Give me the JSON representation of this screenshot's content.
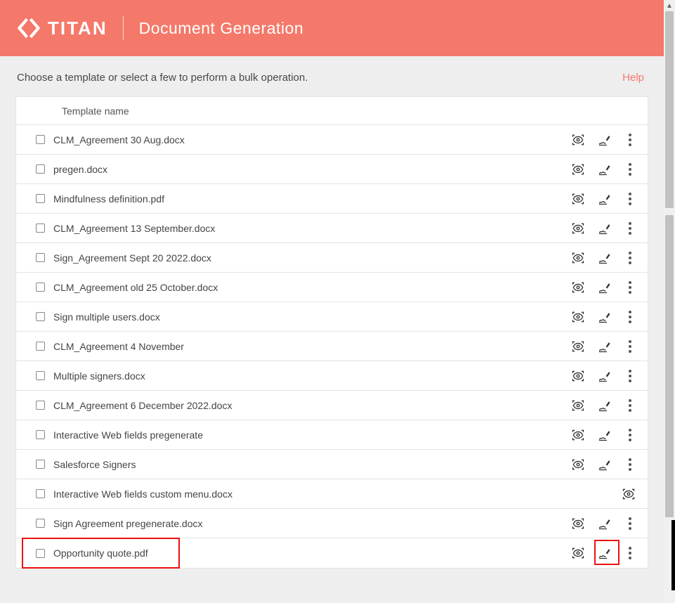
{
  "header": {
    "brand": "TITAN",
    "title": "Document Generation"
  },
  "subhead": {
    "instruction": "Choose a template or select a few to perform a bulk operation.",
    "help": "Help"
  },
  "table": {
    "column_header": "Template name",
    "rows": [
      {
        "name": "CLM_Agreement 30 Aug.docx",
        "preview": true,
        "sign": true,
        "more": true
      },
      {
        "name": "pregen.docx",
        "preview": true,
        "sign": true,
        "more": true
      },
      {
        "name": "Mindfulness definition.pdf",
        "preview": true,
        "sign": true,
        "more": true
      },
      {
        "name": "CLM_Agreement 13 September.docx",
        "preview": true,
        "sign": true,
        "more": true
      },
      {
        "name": "Sign_Agreement Sept 20 2022.docx",
        "preview": true,
        "sign": true,
        "more": true
      },
      {
        "name": "CLM_Agreement old 25 October.docx",
        "preview": true,
        "sign": true,
        "more": true
      },
      {
        "name": "Sign multiple users.docx",
        "preview": true,
        "sign": true,
        "more": true
      },
      {
        "name": "CLM_Agreement 4 November",
        "preview": true,
        "sign": true,
        "more": true
      },
      {
        "name": "Multiple signers.docx",
        "preview": true,
        "sign": true,
        "more": true
      },
      {
        "name": "CLM_Agreement 6 December 2022.docx",
        "preview": true,
        "sign": true,
        "more": true
      },
      {
        "name": "Interactive Web fields pregenerate",
        "preview": true,
        "sign": true,
        "more": true
      },
      {
        "name": "Salesforce Signers",
        "preview": true,
        "sign": true,
        "more": true
      },
      {
        "name": "Interactive Web fields custom menu.docx",
        "preview": true,
        "sign": false,
        "more": false
      },
      {
        "name": "Sign Agreement pregenerate.docx",
        "preview": true,
        "sign": true,
        "more": true
      },
      {
        "name": "Opportunity quote.pdf",
        "preview": true,
        "sign": true,
        "more": true,
        "highlighted": true
      }
    ]
  },
  "colors": {
    "accent": "#f4796a",
    "highlight_border": "#e11"
  }
}
